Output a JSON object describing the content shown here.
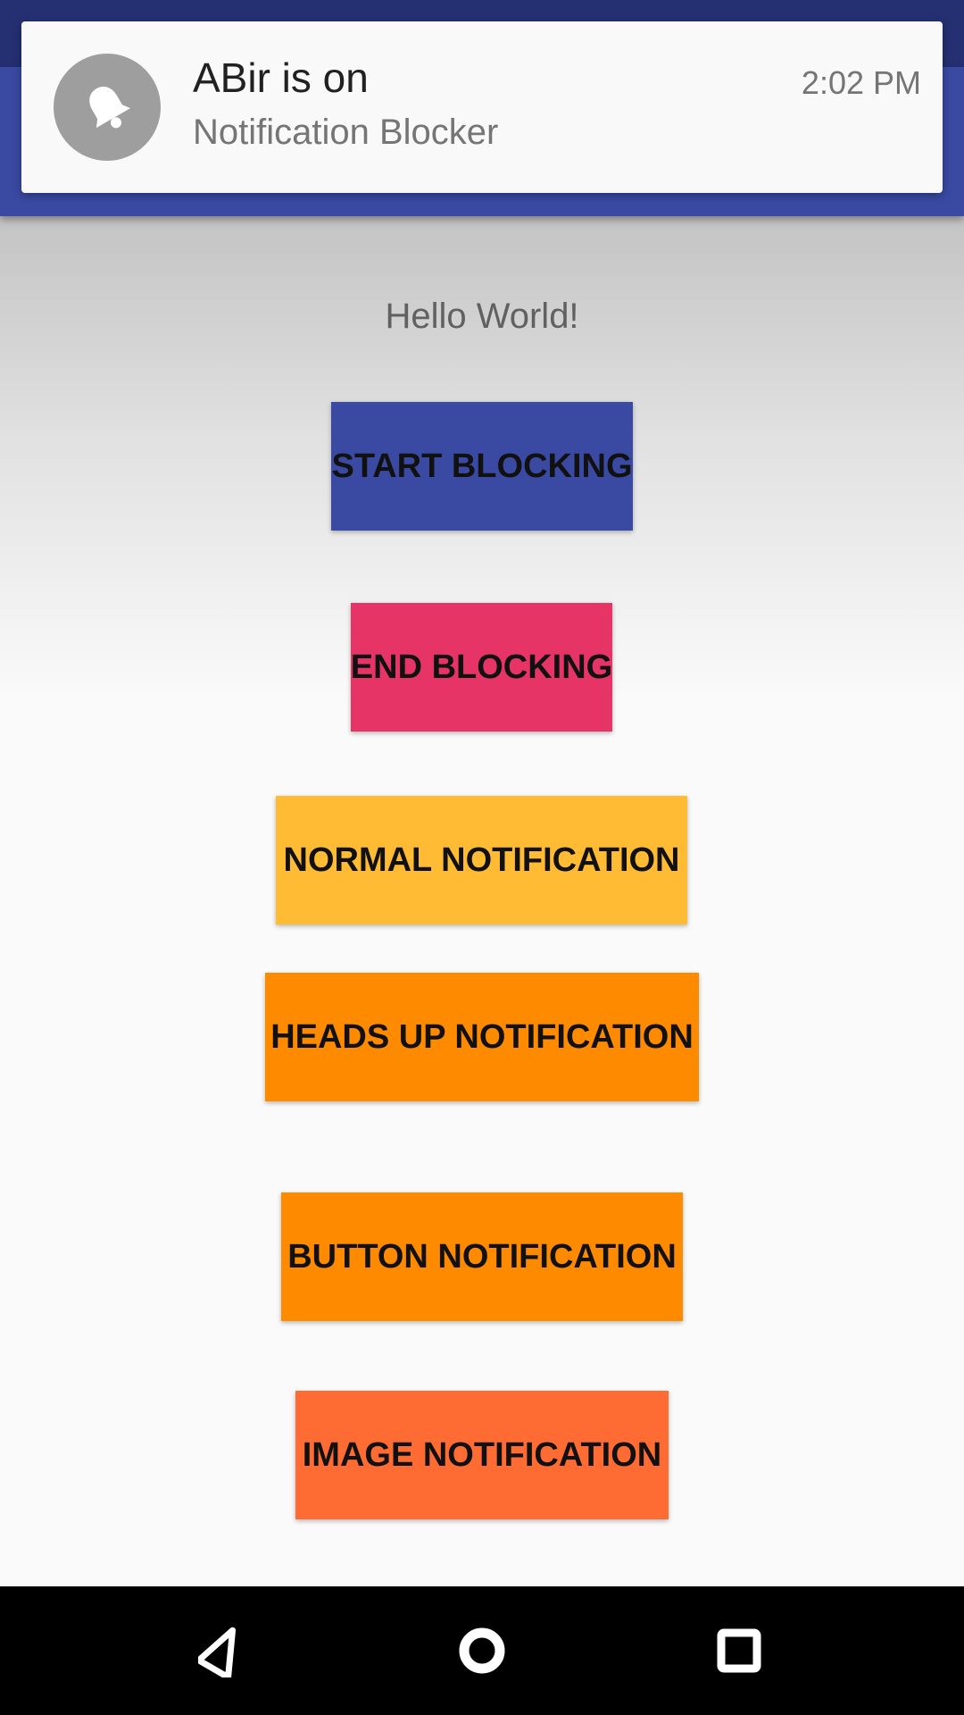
{
  "notification": {
    "app_icon": "bell-icon",
    "title": "ABir is on",
    "text": "Notification Blocker",
    "time": "2:02 PM"
  },
  "main": {
    "hello_text": "Hello World!",
    "buttons": {
      "start_blocking": "START BLOCKING",
      "end_blocking": "END BLOCKING",
      "normal_notification": "NORMAL NOTIFICATION",
      "heads_up_notification": "HEADS UP NOTIFICATION",
      "button_notification": "BUTTON NOTIFICATION",
      "image_notification": "IMAGE NOTIFICATION"
    }
  },
  "nav_bar": {
    "icons": [
      "back-icon",
      "home-icon",
      "recents-icon"
    ]
  },
  "colors": {
    "primary": "#3a4aa3",
    "primary_dark": "#253072",
    "end_button": "#e63466",
    "normal_button": "#febb33",
    "heads_up_button": "#fe8a00",
    "button_button": "#fe8a00",
    "image_button": "#ff6c33"
  }
}
